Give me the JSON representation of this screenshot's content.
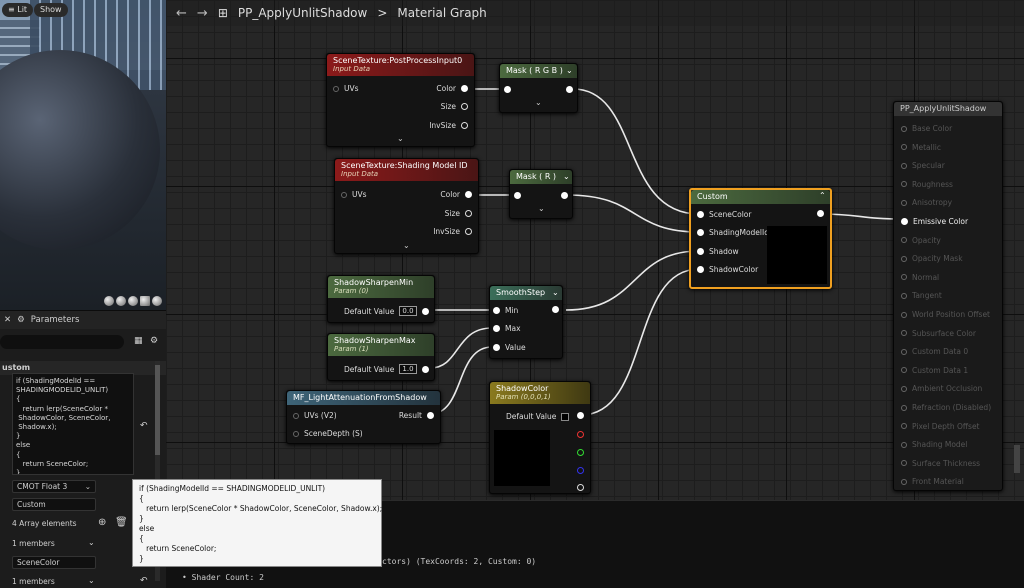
{
  "viewport": {
    "lit_label": "Lit",
    "show_label": "Show"
  },
  "details": {
    "tab_title": "Parameters",
    "section": "ustom",
    "code_lines": "if (ShadingModelId ==\nSHADINGMODELID_UNLIT)\n{\n   return lerp(SceneColor *\n ShadowColor, SceneColor,\n Shadow.x);\n}\nelse\n{\n   return SceneColor;\n}",
    "output_type": "CMOT Float 3",
    "description": "Custom",
    "array_count": "4 Array elements",
    "members1": "1 members",
    "input_name": "SceneColor",
    "members2": "1 members"
  },
  "tooltip": {
    "text": "if (ShadingModelId == SHADINGMODELID_UNLIT)\n{\n   return lerp(SceneColor * ShadowColor, SceneColor, Shadow.x);\n}\nelse\n{\n   return SceneColor;\n}"
  },
  "topbar": {
    "title": "PP_ApplyUnlitShadow",
    "sep": ">",
    "subtitle": "Material Graph"
  },
  "nodes": {
    "st1": {
      "title": "SceneTexture:PostProcessInput0",
      "sub": "Input Data",
      "uvs": "UVs",
      "color": "Color",
      "size": "Size",
      "invsize": "InvSize"
    },
    "st2": {
      "title": "SceneTexture:Shading Model ID",
      "sub": "Input Data",
      "uvs": "UVs",
      "color": "Color",
      "size": "Size",
      "invsize": "InvSize"
    },
    "mask1": {
      "title": "Mask ( R G B )"
    },
    "mask2": {
      "title": "Mask ( R )"
    },
    "smin": {
      "title": "ShadowSharpenMin",
      "sub": "Param (0)",
      "label": "Default Value",
      "value": "0.0"
    },
    "smax": {
      "title": "ShadowSharpenMax",
      "sub": "Param (1)",
      "label": "Default Value",
      "value": "1.0"
    },
    "mf": {
      "title": "MF_LightAttenuationFromShadow",
      "uvs": "UVs (V2)",
      "depth": "SceneDepth (S)",
      "result": "Result"
    },
    "smooth": {
      "title": "SmoothStep",
      "min": "Min",
      "max": "Max",
      "value": "Value"
    },
    "scolor": {
      "title": "ShadowColor",
      "sub": "Param (0,0,0,1)",
      "label": "Default Value"
    },
    "custom": {
      "title": "Custom",
      "p1": "SceneColor",
      "p2": "ShadingModelId",
      "p3": "Shadow",
      "p4": "ShadowColor"
    },
    "result": {
      "title": "PP_ApplyUnlitShadow",
      "pins": [
        "Base Color",
        "Metallic",
        "Specular",
        "Roughness",
        "Anisotropy",
        "Emissive Color",
        "Opacity",
        "Opacity Mask",
        "Normal",
        "Tangent",
        "World Position Offset",
        "Subsurface Color",
        "Custom Data 0",
        "Custom Data 1",
        "Ambient Occlusion",
        "Refraction (Disabled)",
        "Pixel Depth Offset",
        "Shading Model",
        "Surface Thickness",
        "Front Material"
      ]
    }
  },
  "log": {
    "line1": "ctors) (TexCoords: 2, Custom: 0)",
    "line2": "Shader Count: 2"
  },
  "colors": {
    "accent_custom_border": "#f0a020",
    "shadowcolor_header": "#8a7a1f"
  }
}
